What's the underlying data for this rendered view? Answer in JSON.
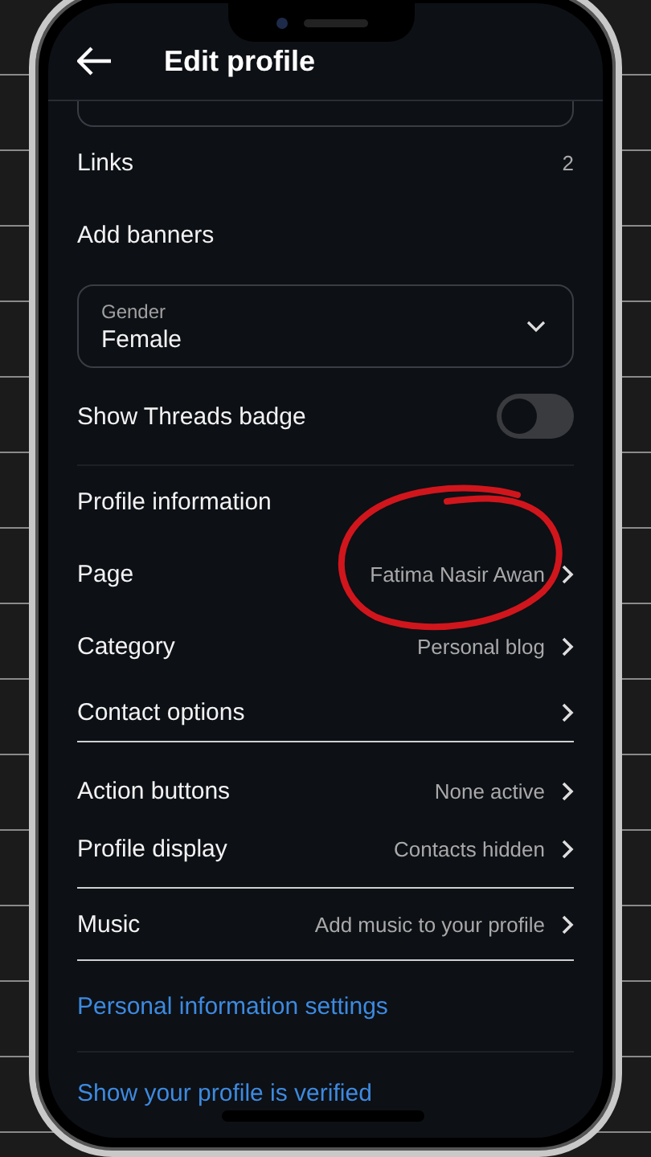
{
  "header": {
    "title": "Edit profile"
  },
  "groups": [
    {
      "items": [
        {
          "kind": "field-stub"
        },
        {
          "kind": "row",
          "label": "Links",
          "value": "2",
          "chevron": false
        },
        {
          "kind": "row",
          "label": "Add banners",
          "chevron": false
        },
        {
          "kind": "select",
          "label": "Gender",
          "value": "Female"
        },
        {
          "kind": "toggle",
          "label": "Show Threads badge",
          "on": false
        }
      ]
    },
    {
      "items": [
        {
          "kind": "heading",
          "label": "Profile information"
        },
        {
          "kind": "row",
          "label": "Page",
          "value": "Fatima Nasir Awan",
          "chevron": true
        },
        {
          "kind": "row",
          "label": "Category",
          "value": "Personal blog",
          "chevron": true
        },
        {
          "kind": "row",
          "label": "Contact options",
          "chevron": true
        }
      ]
    },
    {
      "items": [
        {
          "kind": "row",
          "label": "Action buttons",
          "value": "None active",
          "chevron": true
        },
        {
          "kind": "row",
          "label": "Profile display",
          "value": "Contacts hidden",
          "chevron": true
        }
      ]
    },
    {
      "items": [
        {
          "kind": "row",
          "label": "Music",
          "value": "Add music to your profile",
          "chevron": true
        }
      ]
    },
    {
      "items": [
        {
          "kind": "link",
          "label": "Personal information settings"
        }
      ]
    },
    {
      "items": [
        {
          "kind": "link",
          "label": "Show your profile is verified"
        }
      ]
    }
  ]
}
